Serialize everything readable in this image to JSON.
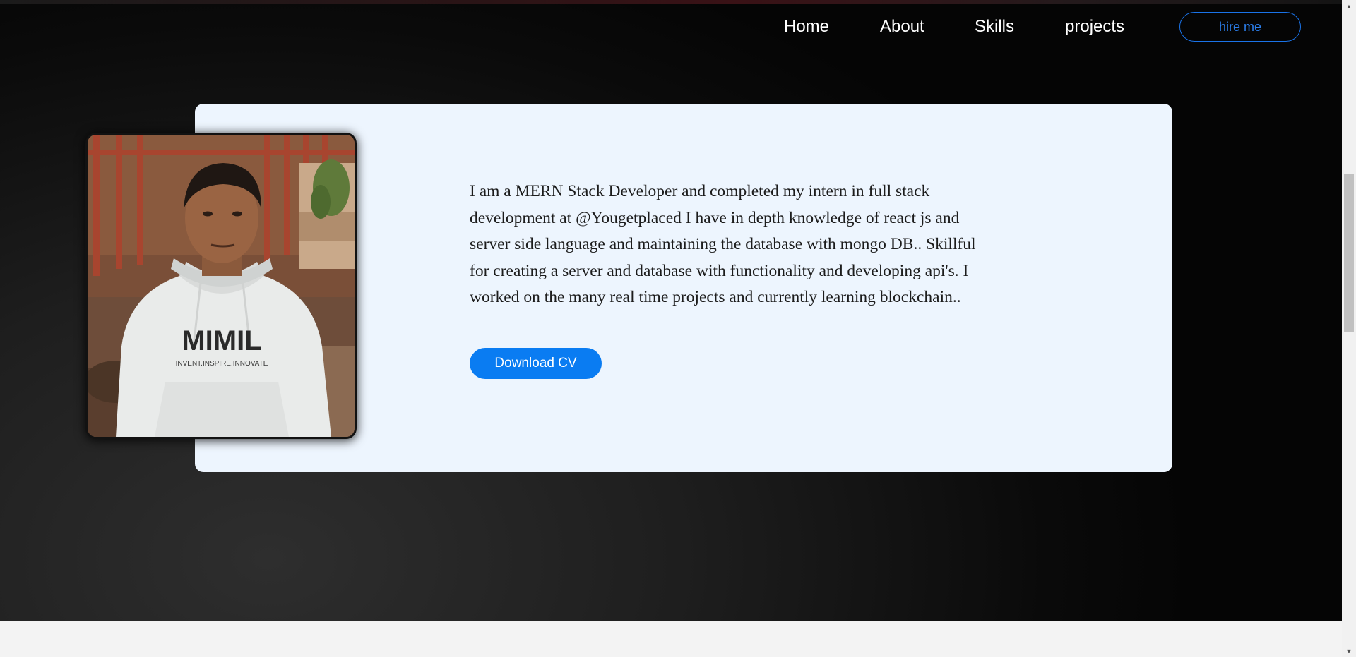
{
  "nav": {
    "items": [
      {
        "label": "Home"
      },
      {
        "label": "About"
      },
      {
        "label": "Skills"
      },
      {
        "label": "projects"
      }
    ],
    "hire_label": "hire me"
  },
  "about": {
    "text": "I am a MERN Stack Developer and completed my intern in full stack development at @Yougetplaced I have in depth knowledge of react js and server side language and maintaining the database with mongo DB.. Skillful for creating a server and database with functionality and developing api's. I worked on the many real time projects and currently learning blockchain..",
    "download_label": "Download CV",
    "photo_shirt_text": "MIMIL",
    "photo_shirt_tagline": "INVENT.INSPIRE.INNOVATE"
  },
  "colors": {
    "accent": "#0a7cf2",
    "card_bg": "#edf5fe",
    "hero_bg": "#1e1e1e"
  },
  "icons": {
    "scroll_up": "triangle-up",
    "scroll_down": "triangle-down"
  }
}
